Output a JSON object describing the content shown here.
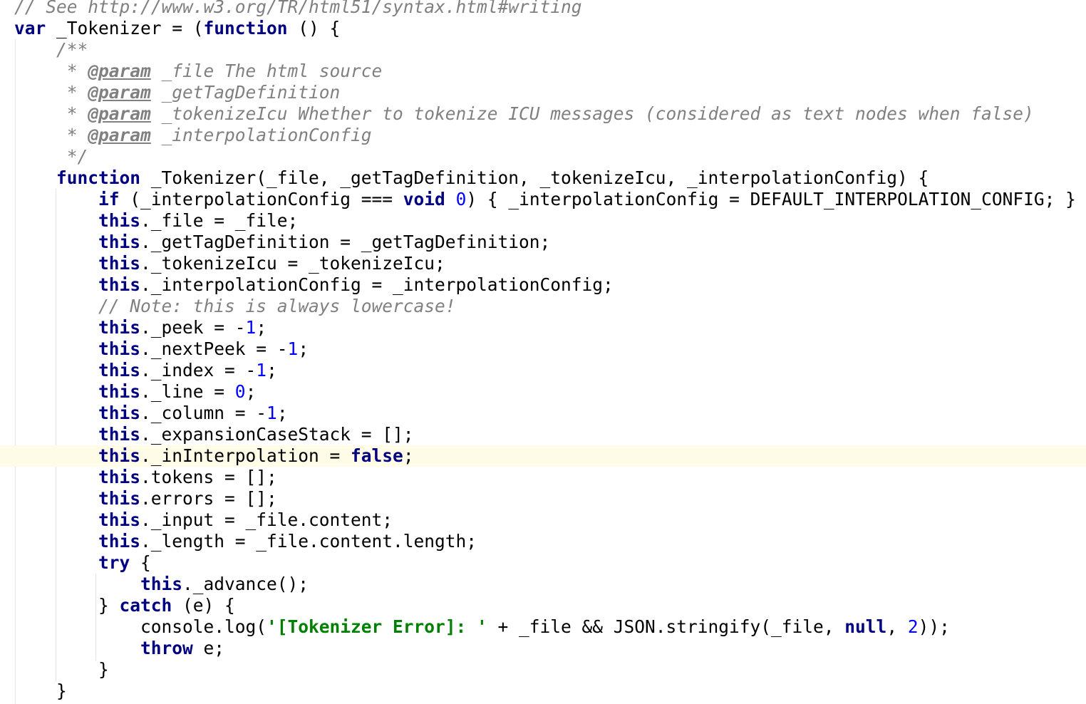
{
  "editor": {
    "highlighted_line": 21,
    "colors": {
      "keyword": "#000080",
      "comment": "#808080",
      "number": "#0000ff",
      "string": "#008000",
      "current_line": "#fefbe6",
      "indent_guide": "#e3e3e3"
    },
    "lines": [
      [
        {
          "t": "// See http://www.w3.org/TR/html51/syntax.html#writing",
          "c": "cm"
        }
      ],
      [
        {
          "t": "var",
          "c": "kw"
        },
        {
          "t": " _Tokenizer = (",
          "c": "tx"
        },
        {
          "t": "function",
          "c": "kw"
        },
        {
          "t": " () {",
          "c": "tx"
        }
      ],
      [
        {
          "t": "    /**",
          "c": "doc"
        }
      ],
      [
        {
          "t": "     * ",
          "c": "doc"
        },
        {
          "t": "@param",
          "c": "tag"
        },
        {
          "t": " _file The html source",
          "c": "doc"
        }
      ],
      [
        {
          "t": "     * ",
          "c": "doc"
        },
        {
          "t": "@param",
          "c": "tag"
        },
        {
          "t": " _getTagDefinition",
          "c": "doc"
        }
      ],
      [
        {
          "t": "     * ",
          "c": "doc"
        },
        {
          "t": "@param",
          "c": "tag"
        },
        {
          "t": " _tokenizeIcu Whether to tokenize ICU messages (considered as text nodes when false)",
          "c": "doc"
        }
      ],
      [
        {
          "t": "     * ",
          "c": "doc"
        },
        {
          "t": "@param",
          "c": "tag"
        },
        {
          "t": " _interpolationConfig",
          "c": "doc"
        }
      ],
      [
        {
          "t": "     */",
          "c": "doc"
        }
      ],
      [
        {
          "t": "    ",
          "c": "tx"
        },
        {
          "t": "function",
          "c": "kw"
        },
        {
          "t": " _Tokenizer(_file, _getTagDefinition, _tokenizeIcu, _interpolationConfig) {",
          "c": "tx"
        }
      ],
      [
        {
          "t": "        ",
          "c": "tx"
        },
        {
          "t": "if",
          "c": "kw"
        },
        {
          "t": " (_interpolationConfig === ",
          "c": "tx"
        },
        {
          "t": "void",
          "c": "kw"
        },
        {
          "t": " ",
          "c": "tx"
        },
        {
          "t": "0",
          "c": "num"
        },
        {
          "t": ") { _interpolationConfig = DEFAULT_INTERPOLATION_CONFIG; }",
          "c": "tx"
        }
      ],
      [
        {
          "t": "        ",
          "c": "tx"
        },
        {
          "t": "this",
          "c": "kw"
        },
        {
          "t": "._file = _file;",
          "c": "tx"
        }
      ],
      [
        {
          "t": "        ",
          "c": "tx"
        },
        {
          "t": "this",
          "c": "kw"
        },
        {
          "t": "._getTagDefinition = _getTagDefinition;",
          "c": "tx"
        }
      ],
      [
        {
          "t": "        ",
          "c": "tx"
        },
        {
          "t": "this",
          "c": "kw"
        },
        {
          "t": "._tokenizeIcu = _tokenizeIcu;",
          "c": "tx"
        }
      ],
      [
        {
          "t": "        ",
          "c": "tx"
        },
        {
          "t": "this",
          "c": "kw"
        },
        {
          "t": "._interpolationConfig = _interpolationConfig;",
          "c": "tx"
        }
      ],
      [
        {
          "t": "        // Note: this is always lowercase!",
          "c": "cm"
        }
      ],
      [
        {
          "t": "        ",
          "c": "tx"
        },
        {
          "t": "this",
          "c": "kw"
        },
        {
          "t": "._peek = -",
          "c": "tx"
        },
        {
          "t": "1",
          "c": "num"
        },
        {
          "t": ";",
          "c": "tx"
        }
      ],
      [
        {
          "t": "        ",
          "c": "tx"
        },
        {
          "t": "this",
          "c": "kw"
        },
        {
          "t": "._nextPeek = -",
          "c": "tx"
        },
        {
          "t": "1",
          "c": "num"
        },
        {
          "t": ";",
          "c": "tx"
        }
      ],
      [
        {
          "t": "        ",
          "c": "tx"
        },
        {
          "t": "this",
          "c": "kw"
        },
        {
          "t": "._index = -",
          "c": "tx"
        },
        {
          "t": "1",
          "c": "num"
        },
        {
          "t": ";",
          "c": "tx"
        }
      ],
      [
        {
          "t": "        ",
          "c": "tx"
        },
        {
          "t": "this",
          "c": "kw"
        },
        {
          "t": "._line = ",
          "c": "tx"
        },
        {
          "t": "0",
          "c": "num"
        },
        {
          "t": ";",
          "c": "tx"
        }
      ],
      [
        {
          "t": "        ",
          "c": "tx"
        },
        {
          "t": "this",
          "c": "kw"
        },
        {
          "t": "._column = -",
          "c": "tx"
        },
        {
          "t": "1",
          "c": "num"
        },
        {
          "t": ";",
          "c": "tx"
        }
      ],
      [
        {
          "t": "        ",
          "c": "tx"
        },
        {
          "t": "this",
          "c": "kw"
        },
        {
          "t": "._expansionCaseStack = [];",
          "c": "tx"
        }
      ],
      [
        {
          "t": "        ",
          "c": "tx"
        },
        {
          "t": "this",
          "c": "kw"
        },
        {
          "t": "._inInterpolation = ",
          "c": "tx"
        },
        {
          "t": "false",
          "c": "kw"
        },
        {
          "t": ";",
          "c": "tx"
        }
      ],
      [
        {
          "t": "        ",
          "c": "tx"
        },
        {
          "t": "this",
          "c": "kw"
        },
        {
          "t": ".tokens = [];",
          "c": "tx"
        }
      ],
      [
        {
          "t": "        ",
          "c": "tx"
        },
        {
          "t": "this",
          "c": "kw"
        },
        {
          "t": ".errors = [];",
          "c": "tx"
        }
      ],
      [
        {
          "t": "        ",
          "c": "tx"
        },
        {
          "t": "this",
          "c": "kw"
        },
        {
          "t": "._input = _file.content;",
          "c": "tx"
        }
      ],
      [
        {
          "t": "        ",
          "c": "tx"
        },
        {
          "t": "this",
          "c": "kw"
        },
        {
          "t": "._length = _file.content.length;",
          "c": "tx"
        }
      ],
      [
        {
          "t": "        ",
          "c": "tx"
        },
        {
          "t": "try",
          "c": "kw"
        },
        {
          "t": " {",
          "c": "tx"
        }
      ],
      [
        {
          "t": "            ",
          "c": "tx"
        },
        {
          "t": "this",
          "c": "kw"
        },
        {
          "t": "._advance();",
          "c": "tx"
        }
      ],
      [
        {
          "t": "        } ",
          "c": "tx"
        },
        {
          "t": "catch",
          "c": "kw"
        },
        {
          "t": " (e) {",
          "c": "tx"
        }
      ],
      [
        {
          "t": "            console.log(",
          "c": "tx"
        },
        {
          "t": "'[Tokenizer Error]: '",
          "c": "str"
        },
        {
          "t": " + _file && JSON.stringify(_file, ",
          "c": "tx"
        },
        {
          "t": "null",
          "c": "kw"
        },
        {
          "t": ", ",
          "c": "tx"
        },
        {
          "t": "2",
          "c": "num"
        },
        {
          "t": "));",
          "c": "tx"
        }
      ],
      [
        {
          "t": "            ",
          "c": "tx"
        },
        {
          "t": "throw",
          "c": "kw"
        },
        {
          "t": " e;",
          "c": "tx"
        }
      ],
      [
        {
          "t": "        }",
          "c": "tx"
        }
      ],
      [
        {
          "t": "    }",
          "c": "tx"
        }
      ]
    ]
  }
}
